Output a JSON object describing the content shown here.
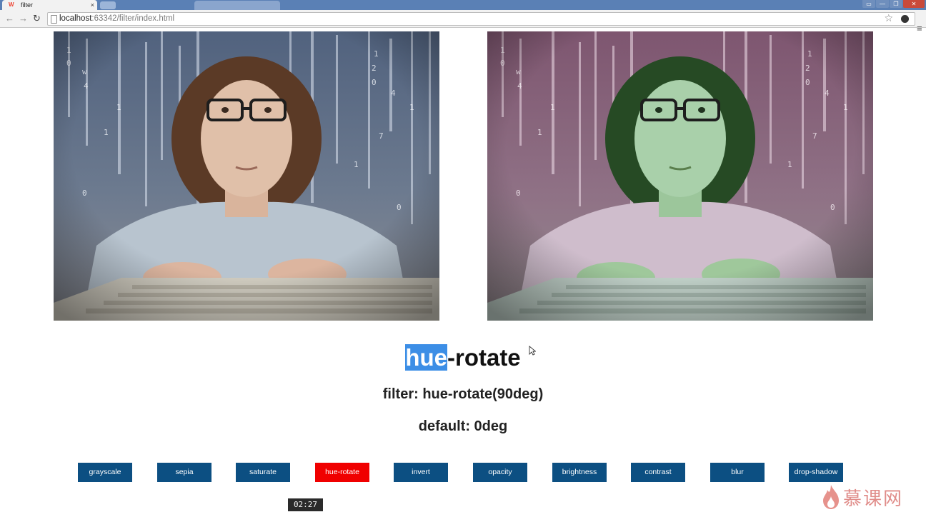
{
  "browser": {
    "tab_title": "filter",
    "tab_close": "×",
    "url_host": "localhost",
    "url_rest": ":63342/filter/index.html",
    "window_buttons": [
      "▭",
      "—",
      "❐",
      "✕"
    ]
  },
  "content": {
    "heading_selected": "hue",
    "heading_rest": "-rotate",
    "filter_line": "filter: hue-rotate(90deg)",
    "default_line": "default: 0deg"
  },
  "buttons": [
    "grayscale",
    "sepia",
    "saturate",
    "hue-rotate",
    "invert",
    "opacity",
    "brightness",
    "contrast",
    "blur",
    "drop-shadow"
  ],
  "active_button": "hue-rotate",
  "overlay": {
    "timecode": "02:27",
    "watermark": "慕课网"
  },
  "colors": {
    "button_bg": "#0c4f82",
    "button_active_bg": "#f00000",
    "selection": "#3c8ee6"
  }
}
